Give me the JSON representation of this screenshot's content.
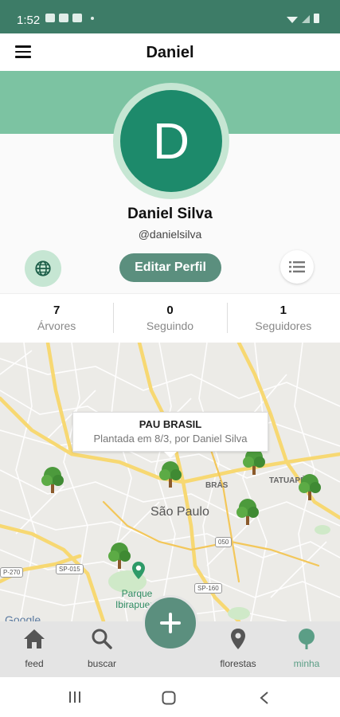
{
  "status_bar": {
    "time": "1:52"
  },
  "app_bar": {
    "title": "Daniel",
    "menu_icon": "hamburger-menu-icon"
  },
  "profile": {
    "avatar_letter": "D",
    "name": "Daniel Silva",
    "handle": "@danielsilva",
    "edit_label": "Editar Perfil",
    "globe_icon": "globe-icon",
    "list_icon": "list-icon"
  },
  "stats": [
    {
      "value": "7",
      "label": "Árvores"
    },
    {
      "value": "0",
      "label": "Seguindo"
    },
    {
      "value": "1",
      "label": "Seguidores"
    }
  ],
  "map": {
    "city_label": "São Paulo",
    "district_labels": [
      "BRÁS",
      "TATUAPÉ"
    ],
    "park_label_line1": "Parque",
    "park_label_line2": "Ibirapuera",
    "road_badges": [
      "SP-015",
      "SP-160",
      "050",
      "P-270"
    ],
    "google_label": "Google",
    "callout": {
      "title": "PAU BRASIL",
      "subtitle": "Plantada em 8/3, por Daniel Silva"
    }
  },
  "bottom_nav": {
    "items": [
      {
        "label": "feed",
        "icon": "home-icon"
      },
      {
        "label": "buscar",
        "icon": "search-icon"
      },
      {
        "label": "florestas",
        "icon": "location-pin-icon"
      },
      {
        "label": "minha",
        "icon": "tree-icon"
      }
    ],
    "fab_icon": "plus-icon"
  },
  "colors": {
    "status_bar": "#3d7c67",
    "banner": "#7cc3a2",
    "avatar": "#1d8a6b",
    "accent": "#5b8f7e",
    "active_nav": "#5b9e86"
  }
}
